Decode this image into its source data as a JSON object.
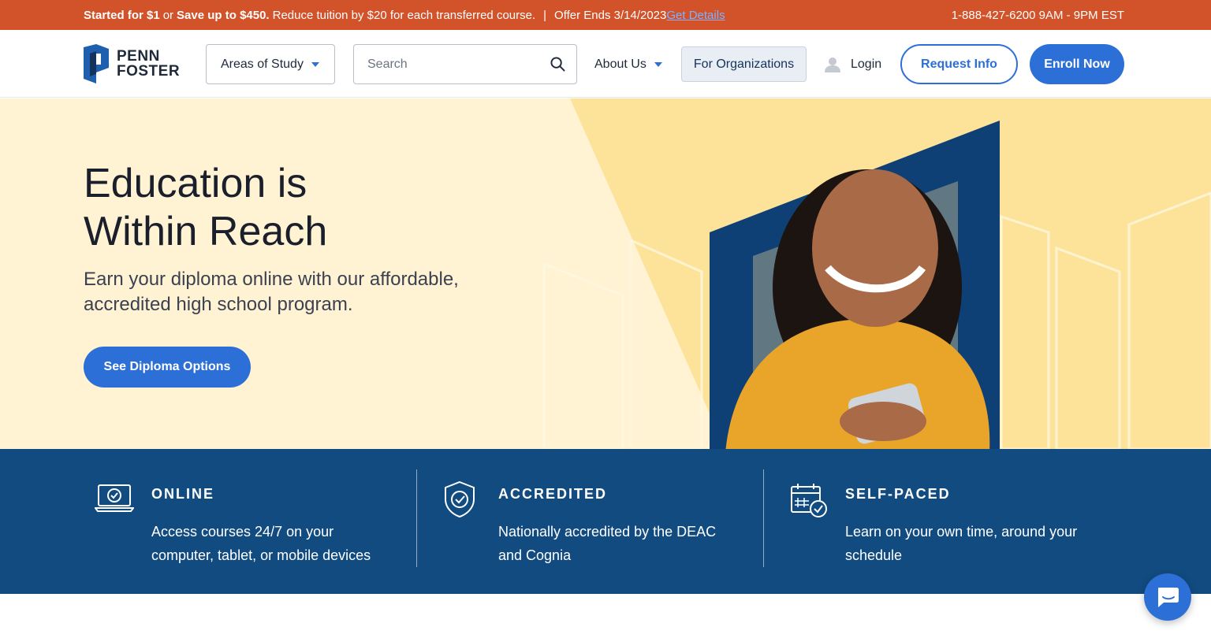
{
  "promo": {
    "bold_1": "Started for $1",
    "text_or": "or",
    "bold_2": "Save up to $450.",
    "text_1": "Reduce tuition by $20 for each transferred course.",
    "separator": "|",
    "offer": "Offer Ends 3/14/2023",
    "link": "Get Details",
    "phone_hours": "1-888-427-6200 9AM - 9PM EST"
  },
  "header": {
    "logo_line1": "PENN",
    "logo_line2": "FOSTER",
    "areas_label": "Areas of Study",
    "search_placeholder": "Search",
    "about_label": "About Us",
    "orgs_label": "For Organizations",
    "login_label": "Login",
    "request_label": "Request Info",
    "enroll_label": "Enroll Now"
  },
  "hero": {
    "title_line1": "Education is",
    "title_line2": "Within Reach",
    "subtitle": "Earn your diploma online with our affordable, accredited high school program.",
    "cta_label": "See Diploma Options"
  },
  "features": [
    {
      "title": "ONLINE",
      "desc": "Access courses 24/7 on your computer, tablet, or mobile devices",
      "icon": "laptop-check-icon"
    },
    {
      "title": "ACCREDITED",
      "desc": "Nationally accredited by the DEAC and Cognia",
      "icon": "shield-check-icon"
    },
    {
      "title": "SELF-PACED",
      "desc": "Learn on your own time, around your schedule",
      "icon": "calendar-check-icon"
    }
  ],
  "colors": {
    "promo_bg": "#d2522a",
    "brand_blue": "#2c6fd6",
    "navy": "#124b80",
    "hero_bg": "#fff3d4",
    "hero_accent": "#fde39a"
  }
}
